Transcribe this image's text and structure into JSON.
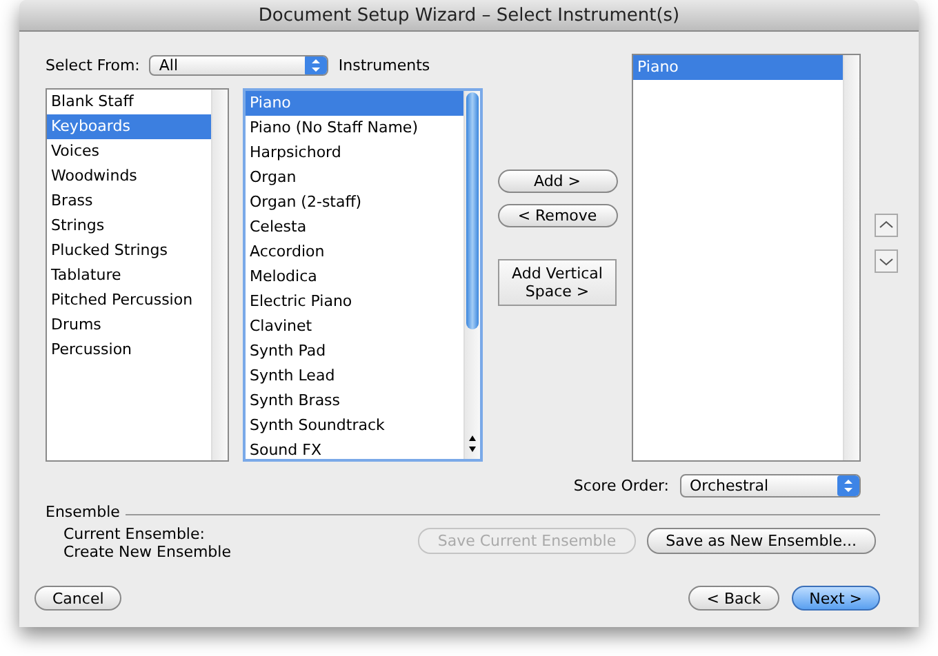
{
  "window": {
    "title": "Document Setup Wizard – Select Instrument(s)"
  },
  "select_from": {
    "label": "Select From:",
    "value": "All",
    "suffix": "Instruments"
  },
  "categories": [
    {
      "label": "Blank Staff",
      "selected": false
    },
    {
      "label": "Keyboards",
      "selected": true
    },
    {
      "label": "Voices",
      "selected": false
    },
    {
      "label": "Woodwinds",
      "selected": false
    },
    {
      "label": "Brass",
      "selected": false
    },
    {
      "label": "Strings",
      "selected": false
    },
    {
      "label": "Plucked Strings",
      "selected": false
    },
    {
      "label": "Tablature",
      "selected": false
    },
    {
      "label": "Pitched Percussion",
      "selected": false
    },
    {
      "label": "Drums",
      "selected": false
    },
    {
      "label": "Percussion",
      "selected": false
    }
  ],
  "instruments": [
    {
      "label": "Piano",
      "selected": true
    },
    {
      "label": "Piano (No Staff Name)",
      "selected": false
    },
    {
      "label": "Harpsichord",
      "selected": false
    },
    {
      "label": "Organ",
      "selected": false
    },
    {
      "label": "Organ (2-staff)",
      "selected": false
    },
    {
      "label": "Celesta",
      "selected": false
    },
    {
      "label": "Accordion",
      "selected": false
    },
    {
      "label": "Melodica",
      "selected": false
    },
    {
      "label": "Electric Piano",
      "selected": false
    },
    {
      "label": "Clavinet",
      "selected": false
    },
    {
      "label": "Synth Pad",
      "selected": false
    },
    {
      "label": "Synth Lead",
      "selected": false
    },
    {
      "label": "Synth Brass",
      "selected": false
    },
    {
      "label": "Synth Soundtrack",
      "selected": false
    },
    {
      "label": "Sound FX",
      "selected": false
    }
  ],
  "actions": {
    "add": "Add >",
    "remove": "< Remove",
    "add_space": "Add Vertical Space >"
  },
  "selected_instruments": [
    {
      "label": "Piano",
      "selected": true
    }
  ],
  "score_order": {
    "label": "Score Order:",
    "value": "Orchestral"
  },
  "ensemble": {
    "heading": "Ensemble",
    "current_label": "Current Ensemble:",
    "current_value": "Create New Ensemble",
    "buttons": [
      {
        "label": "Save Current Ensemble",
        "disabled": true
      },
      {
        "label": "Save as New Ensemble...",
        "disabled": false
      }
    ]
  },
  "footer": {
    "cancel": "Cancel",
    "buttons": [
      {
        "label": "< Back",
        "default": false
      },
      {
        "label": "Next >",
        "default": true
      }
    ]
  }
}
